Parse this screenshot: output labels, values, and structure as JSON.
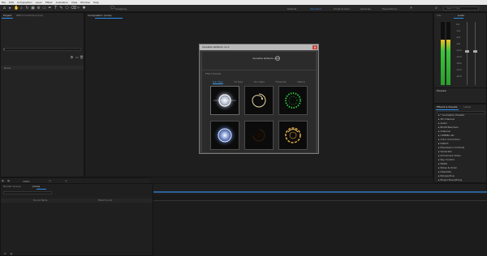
{
  "menubar": {
    "items": [
      "File",
      "Edit",
      "Composition",
      "Layer",
      "Effect",
      "Animation",
      "View",
      "Window",
      "Help"
    ]
  },
  "toolbar": {
    "snapping": "Snapping",
    "workspaces": [
      "Default",
      "Standard",
      "Small Screen",
      "Libraries",
      "Essential Gr."
    ],
    "active_workspace": "Standard",
    "search_placeholder": "Search Help"
  },
  "project_panel": {
    "tabs": [
      "Project",
      "Effect Controls (none)"
    ],
    "column_name": "Name"
  },
  "composition_panel": {
    "tab": "Composition (none)"
  },
  "dialog": {
    "title": "Versatile Reflects v1.0",
    "heading": "Versatile Reflects v1.0",
    "help": "?",
    "close": "✕",
    "section_label": "Effect Presets",
    "tabs": [
      "Sun Type",
      "3d Type",
      "Sun Style",
      "Fireworks",
      "Nature"
    ],
    "active_tab": "Sun Type"
  },
  "status": {
    "zoom": "100%"
  },
  "timeline": {
    "tabs": [
      "Render Queue",
      "(none)"
    ],
    "columns": [
      "Source Name",
      "Parent & Link"
    ]
  },
  "right_panels": {
    "info_tabs": [
      "Info",
      "Audio"
    ],
    "audio_db": [
      "0.0",
      "-3.0",
      "-6.0",
      "-9.0",
      "-12.0",
      "-15.0",
      "-18.0",
      "-21.0",
      "-24.0"
    ],
    "preview_tab": "Preview",
    "effects_tab": "Effects & Presets",
    "libraries_tab": "Librar",
    "effects_items": [
      "* Animation Presets",
      "3D Channel",
      "Audio",
      "BCC8 Blenders",
      "Channel",
      "CINEMA 4D",
      "Color Correction",
      "Distort",
      "Expression Controls",
      "Generate",
      "Immersive Video",
      "Key Control",
      "Matte",
      "Noise & Grain",
      "Obsolete",
      "Perspective",
      "Plugin Everything",
      "Primatte",
      "Red Giant"
    ]
  },
  "colors": {
    "accent": "#2d8ceb",
    "panel": "#232323",
    "background": "#1d1d1d"
  }
}
